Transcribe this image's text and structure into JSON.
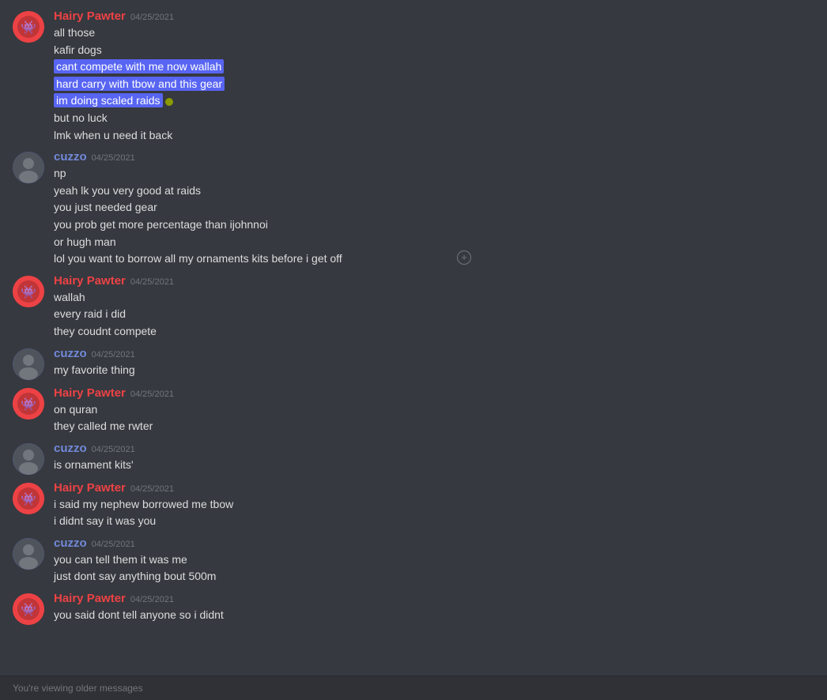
{
  "messages": [
    {
      "id": "msg1",
      "author": "Hairy Pawter",
      "authorClass": "hairy",
      "timestamp": "04/25/2021",
      "lines": [
        {
          "text": "all those",
          "highlight": false
        },
        {
          "text": "kafir dogs",
          "highlight": false
        },
        {
          "text": "cant compete with me now wallah",
          "highlight": true
        },
        {
          "text": "hard carry with tbow and this gear",
          "highlight": true
        },
        {
          "text": "im doing scaled raids",
          "highlight": true
        },
        {
          "text": "but no luck",
          "highlight": false
        },
        {
          "text": "lmk when u need it back",
          "highlight": false
        }
      ]
    },
    {
      "id": "msg2",
      "author": "cuzzo",
      "authorClass": "cuzzo",
      "timestamp": "04/25/2021",
      "lines": [
        {
          "text": "np",
          "highlight": false
        },
        {
          "text": "yeah lk you very good at raids",
          "highlight": false
        },
        {
          "text": "you just needed gear",
          "highlight": false
        },
        {
          "text": "you prob get more percentage than ijohnnoi",
          "highlight": false
        },
        {
          "text": "or hugh man",
          "highlight": false
        },
        {
          "text": "lol you want to borrow all my ornaments kits before i get off",
          "highlight": false
        }
      ]
    },
    {
      "id": "msg3",
      "author": "Hairy Pawter",
      "authorClass": "hairy",
      "timestamp": "04/25/2021",
      "lines": [
        {
          "text": "wallah",
          "highlight": false
        },
        {
          "text": "every raid i did",
          "highlight": false
        },
        {
          "text": "they coudnt compete",
          "highlight": false
        }
      ]
    },
    {
      "id": "msg4",
      "author": "cuzzo",
      "authorClass": "cuzzo",
      "timestamp": "04/25/2021",
      "lines": [
        {
          "text": "my favorite thing",
          "highlight": false
        }
      ]
    },
    {
      "id": "msg5",
      "author": "Hairy Pawter",
      "authorClass": "hairy",
      "timestamp": "04/25/2021",
      "lines": [
        {
          "text": "on quran",
          "highlight": false
        },
        {
          "text": "they called me rwter",
          "highlight": false
        }
      ]
    },
    {
      "id": "msg6",
      "author": "cuzzo",
      "authorClass": "cuzzo",
      "timestamp": "04/25/2021",
      "lines": [
        {
          "text": "is ornament kits'",
          "highlight": false
        }
      ]
    },
    {
      "id": "msg7",
      "author": "Hairy Pawter",
      "authorClass": "hairy",
      "timestamp": "04/25/2021",
      "lines": [
        {
          "text": "i said my nephew borrowed me tbow",
          "highlight": false
        },
        {
          "text": "i didnt say it was you",
          "highlight": false
        }
      ]
    },
    {
      "id": "msg8",
      "author": "cuzzo",
      "authorClass": "cuzzo",
      "timestamp": "04/25/2021",
      "lines": [
        {
          "text": "you can tell them it was me",
          "highlight": false
        },
        {
          "text": "just dont say anything bout 500m",
          "highlight": false
        }
      ]
    },
    {
      "id": "msg9",
      "author": "Hairy Pawter",
      "authorClass": "hairy",
      "timestamp": "04/25/2021",
      "lines": [
        {
          "text": "you said dont tell anyone so i didnt",
          "highlight": false
        }
      ]
    }
  ],
  "status_bar": {
    "text": "You're viewing older messages"
  }
}
